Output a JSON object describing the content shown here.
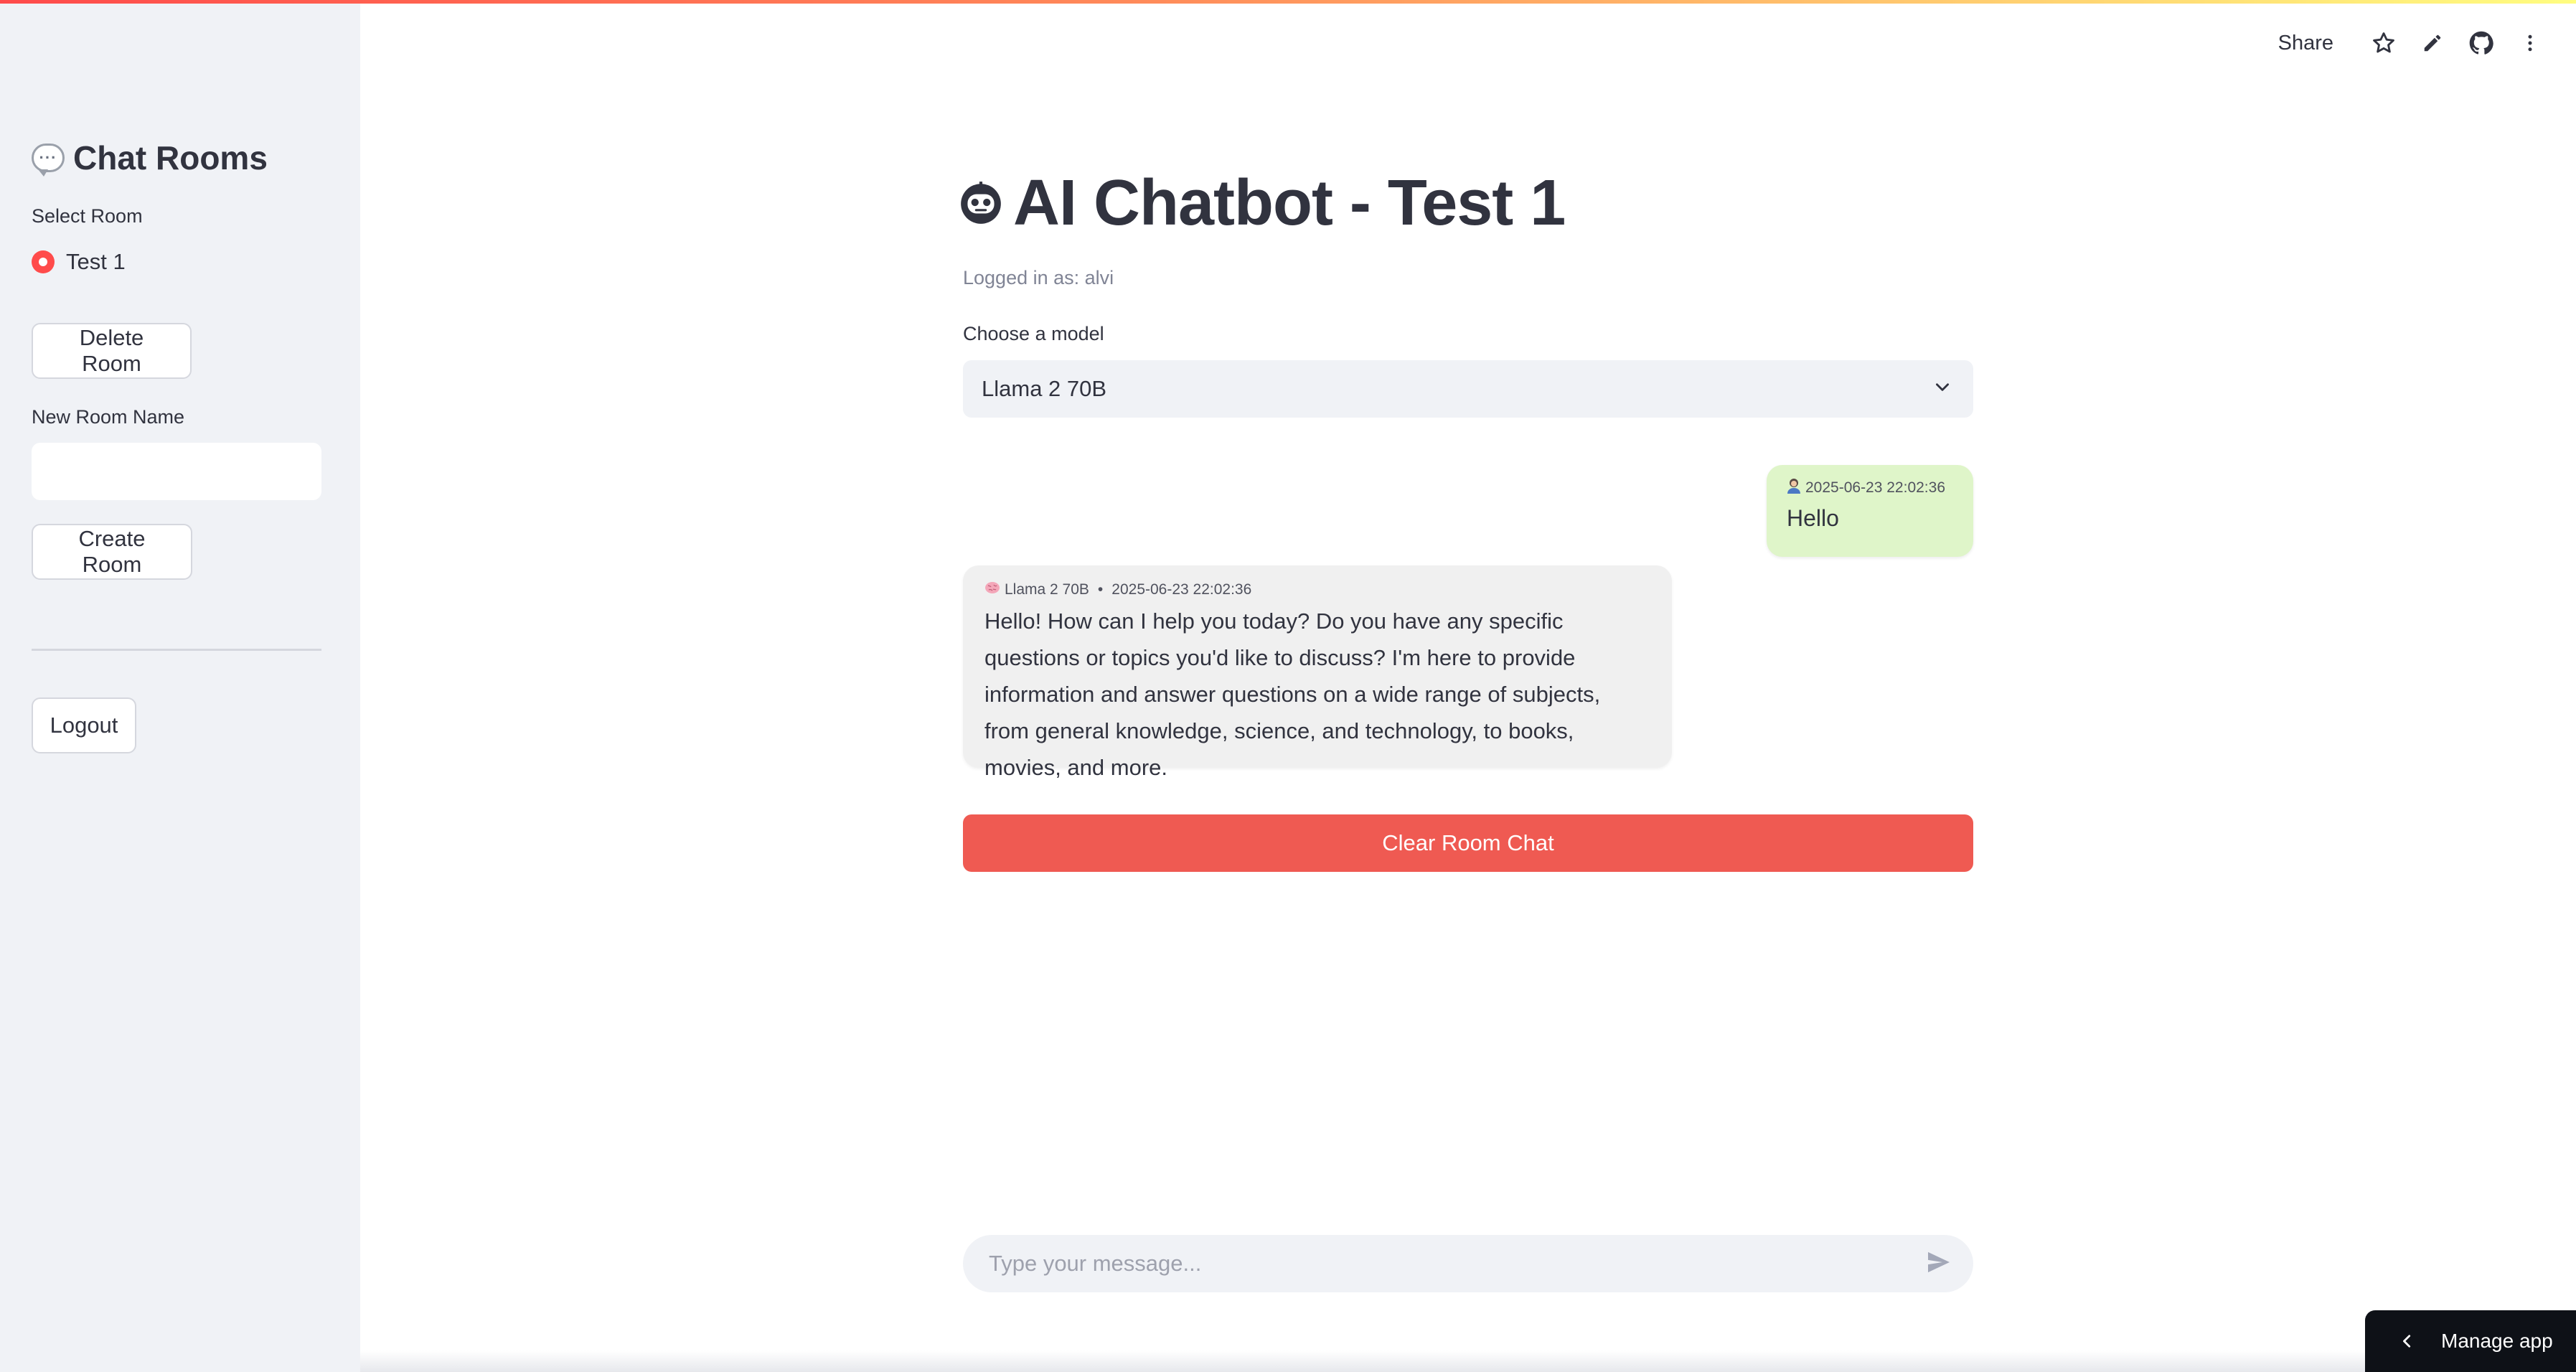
{
  "sidebar": {
    "title": "Chat Rooms",
    "title_icon": "speech-bubble-icon",
    "select_label": "Select Room",
    "rooms": [
      {
        "label": "Test 1",
        "selected": true
      }
    ],
    "delete_button": "Delete Room",
    "new_room_label": "New Room Name",
    "new_room_value": "",
    "create_button": "Create Room",
    "logout_button": "Logout"
  },
  "toolbar": {
    "share": "Share",
    "icons": [
      "star-icon",
      "edit-pencil-icon",
      "github-icon",
      "more-vertical-icon"
    ]
  },
  "main": {
    "title": "AI Chatbot - Test 1",
    "title_icon": "robot-icon",
    "logged_in": "Logged in as: alvi",
    "model_label": "Choose a model",
    "model_value": "Llama 2 70B",
    "messages": [
      {
        "role": "user",
        "avatar": "user-avatar-icon",
        "timestamp": "2025-06-23 22:02:36",
        "text": "Hello"
      },
      {
        "role": "assistant",
        "avatar": "brain-icon",
        "model": "Llama 2 70B",
        "separator": "•",
        "timestamp": "2025-06-23 22:02:36",
        "text": "Hello! How can I help you today? Do you have any specific questions or topics you'd like to discuss? I'm here to provide information and answer questions on a wide range of subjects, from general knowledge, science, and technology, to books, movies, and more."
      }
    ],
    "clear_button": "Clear Room Chat",
    "chat_placeholder": "Type your message..."
  },
  "manage_app": "Manage app",
  "colors": {
    "primary": "#ff4b4b",
    "clear_button": "#ef5a52",
    "user_bubble": "#dff5c9",
    "bot_bubble": "#f0f0f0",
    "sidebar_bg": "#f0f2f6"
  }
}
